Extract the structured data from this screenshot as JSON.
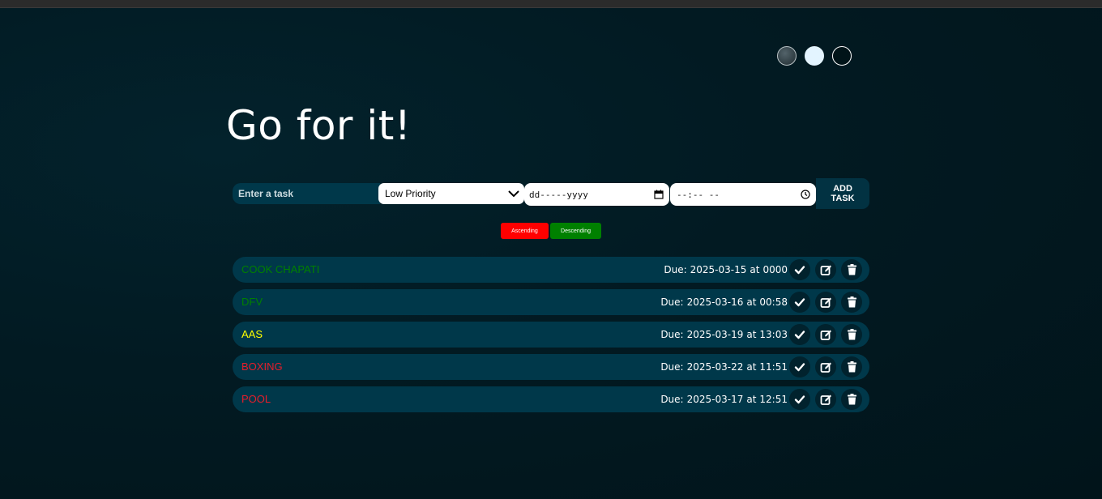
{
  "app": {
    "title": "Go for it!"
  },
  "themes": [
    "standard",
    "light",
    "darker"
  ],
  "form": {
    "task_placeholder": "Enter a task",
    "task_value": "",
    "priority_selected": "Low Priority",
    "date_placeholder": "dd-----yyyy",
    "time_placeholder": "--:-- --",
    "add_label": "ADD\nTASK"
  },
  "sort": {
    "ascending_label": "Ascending",
    "descending_label": "Descending",
    "ascending_color": "#ff0000",
    "descending_color": "#008000"
  },
  "due_label": "Due:",
  "due_separator": "at",
  "priority_colors": {
    "low": "#008000",
    "medium": "#ffff00",
    "high": "#e81d2a"
  },
  "tasks": [
    {
      "name": "COOK CHAPATI",
      "due_date": "2025-03-15",
      "due_time": "0000",
      "priority": "low",
      "color": "#008000"
    },
    {
      "name": "DFV",
      "due_date": "2025-03-16",
      "due_time": "00:58",
      "priority": "low",
      "color": "#008000"
    },
    {
      "name": "AAS",
      "due_date": "2025-03-19",
      "due_time": "13:03",
      "priority": "medium",
      "color": "#ffff00"
    },
    {
      "name": "BOXING",
      "due_date": "2025-03-22",
      "due_time": "11:51",
      "priority": "high",
      "color": "#e81d2a"
    },
    {
      "name": "POOL",
      "due_date": "2025-03-17",
      "due_time": "12:51",
      "priority": "high",
      "color": "#e81d2a"
    }
  ],
  "icons": {
    "complete": "check-icon",
    "edit": "edit-icon",
    "delete": "trash-icon"
  }
}
